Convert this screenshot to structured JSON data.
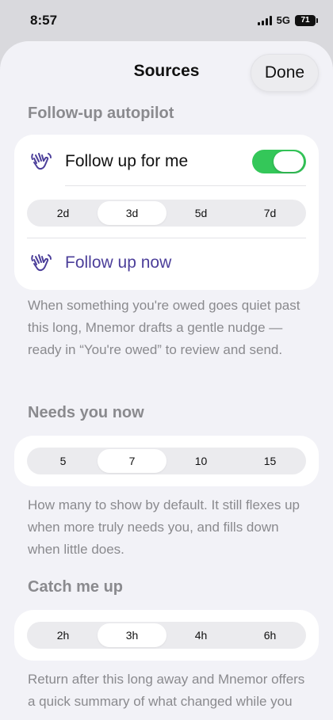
{
  "status": {
    "time": "8:57",
    "network": "5G",
    "battery": "71"
  },
  "sheet": {
    "title": "Sources",
    "done_label": "Done"
  },
  "followup": {
    "header": "Follow-up autopilot",
    "toggle_label": "Follow up for me",
    "toggle_on": true,
    "options": [
      "2d",
      "3d",
      "5d",
      "7d"
    ],
    "selected": 1,
    "action_label": "Follow up now",
    "footnote": "When something you're owed goes quiet past this long, Mnemor drafts a gentle nudge — ready in “You're owed” to review and send."
  },
  "needs": {
    "header": "Needs you now",
    "options": [
      "5",
      "7",
      "10",
      "15"
    ],
    "selected": 1,
    "footnote": "How many to show by default. It still flexes up when more truly needs you, and fills down when little does."
  },
  "catchup": {
    "header": "Catch me up",
    "options": [
      "2h",
      "3h",
      "4h",
      "6h"
    ],
    "selected": 1,
    "footnote": "Return after this long away and Mnemor offers a quick summary of what changed while you were gone."
  },
  "colors": {
    "accent": "#4c3f9a",
    "toggle_on": "#34c759"
  },
  "icons": {
    "followup": "waving-hand-icon"
  }
}
